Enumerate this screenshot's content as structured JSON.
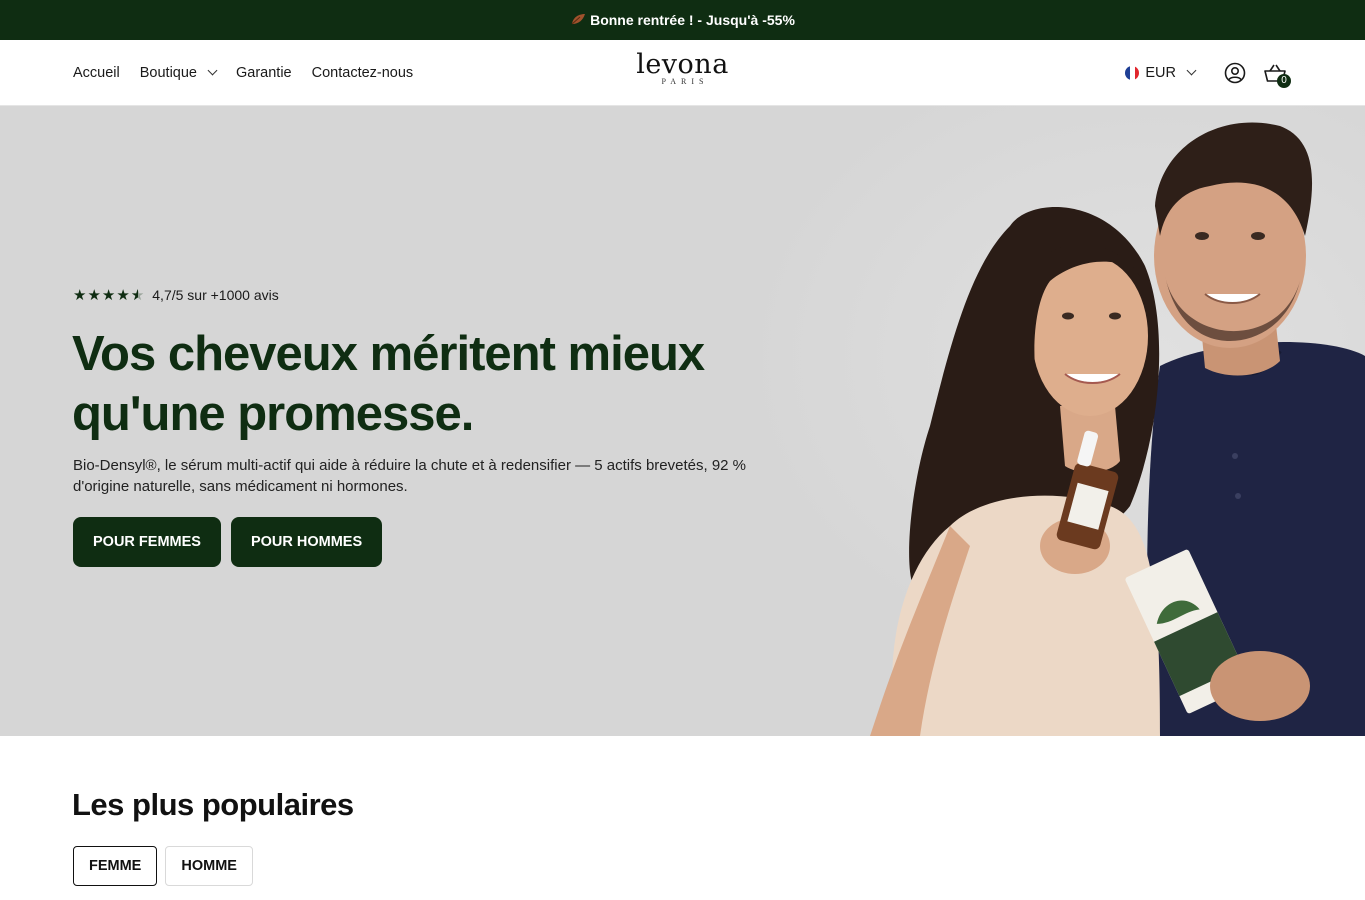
{
  "announcement": {
    "emoji_icon": "autumn-leaf-icon",
    "text": "Bonne rentrée ! - Jusqu'à -55%"
  },
  "header": {
    "nav": [
      {
        "label": "Accueil"
      },
      {
        "label": "Boutique",
        "has_dropdown": true
      },
      {
        "label": "Garantie"
      },
      {
        "label": "Contactez-nous"
      }
    ],
    "logo": {
      "word": "levona",
      "sub": "PARIS"
    },
    "currency": {
      "label": "EUR",
      "flag": "france-flag-icon"
    },
    "account_icon": "user-circle-icon",
    "cart": {
      "icon": "basket-icon",
      "count": "0"
    }
  },
  "hero": {
    "rating_value": 4.5,
    "rating_text": "4,7/5 sur +1000 avis",
    "title": "Vos cheveux méritent mieux qu'une promesse.",
    "description": "Bio-Densyl®, le sérum multi-actif qui aide à réduire la chute et à redensifier — 5 actifs brevetés, 92 % d'origine naturelle, sans médicament ni hormones.",
    "cta_women": "POUR FEMMES",
    "cta_men": "POUR HOMMES"
  },
  "popular": {
    "title": "Les plus populaires",
    "tabs": [
      {
        "label": "FEMME",
        "active": true
      },
      {
        "label": "HOMME",
        "active": false
      }
    ]
  },
  "colors": {
    "brand_green": "#0f2d12",
    "hero_bg": "#d6d6d6"
  }
}
